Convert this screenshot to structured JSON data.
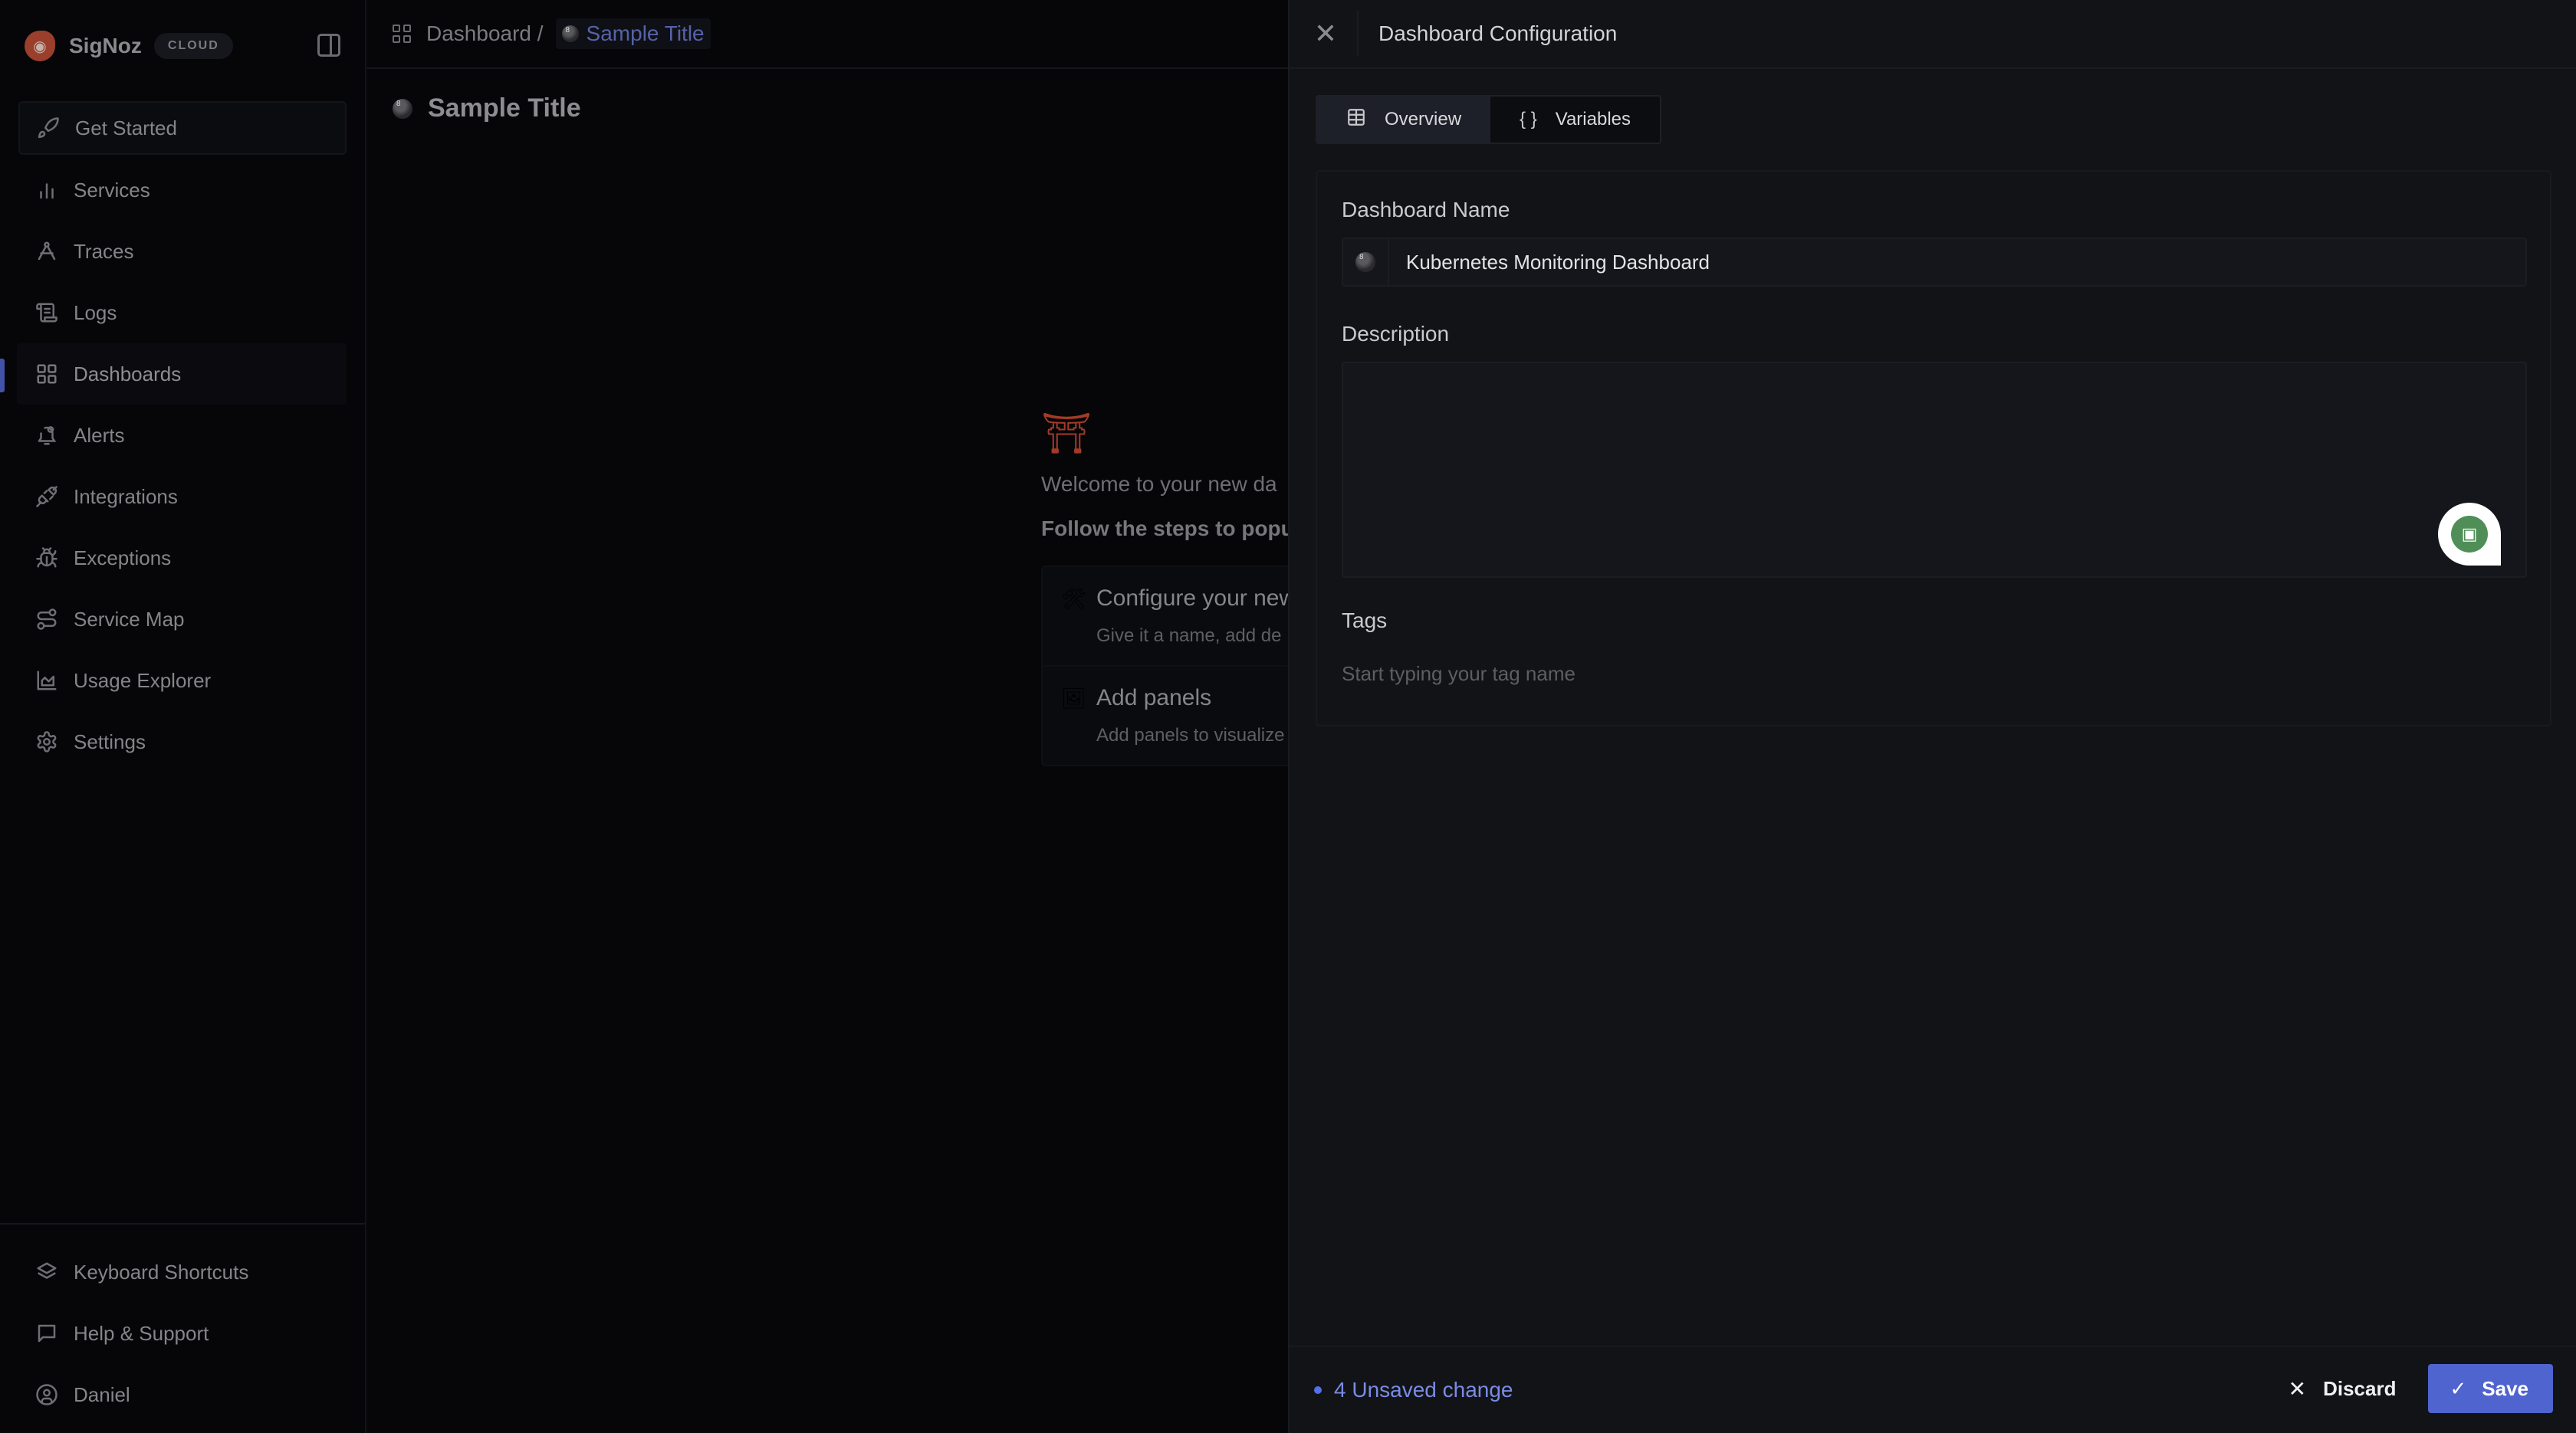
{
  "sidebar": {
    "brand": "SigNoz",
    "badge": "CLOUD",
    "get_started": "Get Started",
    "items": [
      {
        "label": "Services",
        "icon": "bar-chart-icon"
      },
      {
        "label": "Traces",
        "icon": "traces-icon"
      },
      {
        "label": "Logs",
        "icon": "scroll-icon"
      },
      {
        "label": "Dashboards",
        "icon": "grid-icon",
        "active": true
      },
      {
        "label": "Alerts",
        "icon": "bell-icon"
      },
      {
        "label": "Integrations",
        "icon": "plug-icon"
      },
      {
        "label": "Exceptions",
        "icon": "bug-icon"
      },
      {
        "label": "Service Map",
        "icon": "route-icon"
      },
      {
        "label": "Usage Explorer",
        "icon": "area-chart-icon"
      },
      {
        "label": "Settings",
        "icon": "gear-icon"
      }
    ],
    "bottom": [
      {
        "label": "Keyboard Shortcuts",
        "icon": "layers-icon"
      },
      {
        "label": "Help & Support",
        "icon": "message-icon"
      },
      {
        "label": "Daniel",
        "icon": "user-circle-icon"
      }
    ]
  },
  "main": {
    "breadcrumb": {
      "root": "Dashboard /",
      "current": "Sample Title"
    },
    "page_title": "Sample Title",
    "welcome": {
      "emoji": "⛩",
      "text": "Welcome to your new da",
      "sub": "Follow the steps to popu"
    },
    "steps": [
      {
        "emoji": "🛠",
        "title": "Configure your new",
        "desc": "Give it a name, add de"
      },
      {
        "emoji": "🖼",
        "title": "Add panels",
        "desc": "Add panels to visualize"
      }
    ]
  },
  "drawer": {
    "title": "Dashboard Configuration",
    "tabs": [
      {
        "label": "Overview",
        "icon": "table-icon",
        "active": true
      },
      {
        "label": "Variables",
        "icon": "braces-icon"
      }
    ],
    "form": {
      "name_label": "Dashboard Name",
      "name_value": "Kubernetes Monitoring Dashboard",
      "description_label": "Description",
      "description_value": "",
      "tags_label": "Tags",
      "tags_placeholder": "Start typing your tag name"
    },
    "footer": {
      "unsaved": "4 Unsaved change",
      "discard": "Discard",
      "save": "Save"
    }
  },
  "colors": {
    "accent": "#4f64ce",
    "unsaved": "#7a8ce4",
    "active_bar": "#4152a8",
    "brand_logo": "#b34a33"
  }
}
